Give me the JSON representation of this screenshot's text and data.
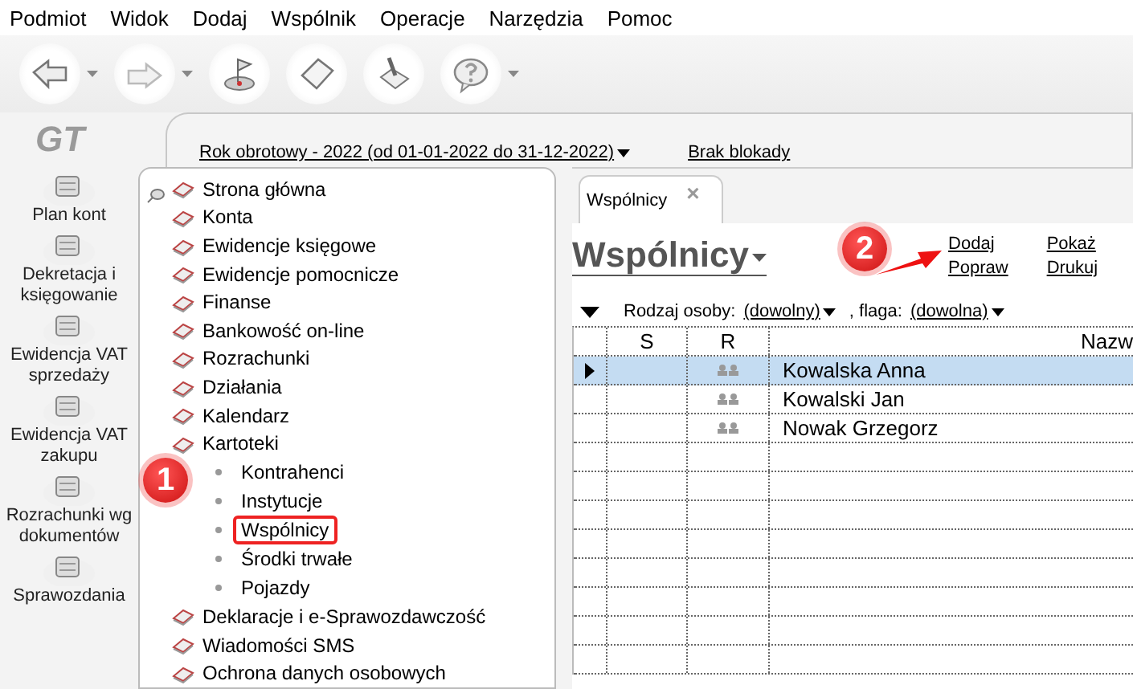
{
  "menu": [
    "Podmiot",
    "Widok",
    "Dodaj",
    "Wspólnik",
    "Operacje",
    "Narzędzia",
    "Pomoc"
  ],
  "toolbar": [
    {
      "kind": "back",
      "dropdown": true
    },
    {
      "kind": "forward",
      "dropdown": true
    },
    {
      "kind": "flag",
      "dropdown": false
    },
    {
      "kind": "page",
      "dropdown": false
    },
    {
      "kind": "brush",
      "dropdown": false
    },
    {
      "kind": "help",
      "dropdown": true
    }
  ],
  "logo": "GT",
  "sidebar": [
    {
      "label": "Plan kont"
    },
    {
      "label": "Dekretacja i księgowanie"
    },
    {
      "label": "Ewidencja VAT sprzedaży"
    },
    {
      "label": "Ewidencja VAT zakupu"
    },
    {
      "label": "Rozrachunki wg dokumentów"
    },
    {
      "label": "Sprawozdania"
    }
  ],
  "header": {
    "fiscal_year": "Rok obrotowy - 2022  (od 01-01-2022 do 31-12-2022)",
    "lock": "Brak blokady"
  },
  "tree": [
    {
      "label": "Strona główna"
    },
    {
      "label": "Konta"
    },
    {
      "label": "Ewidencje księgowe"
    },
    {
      "label": "Ewidencje pomocnicze"
    },
    {
      "label": "Finanse"
    },
    {
      "label": "Bankowość on-line"
    },
    {
      "label": "Rozrachunki"
    },
    {
      "label": "Działania"
    },
    {
      "label": "Kalendarz"
    },
    {
      "label": "Kartoteki",
      "children": [
        {
          "label": "Kontrahenci",
          "highlighted": false
        },
        {
          "label": "Instytucje",
          "highlighted": false
        },
        {
          "label": "Wspólnicy",
          "highlighted": true
        },
        {
          "label": "Środki trwałe",
          "highlighted": false
        },
        {
          "label": "Pojazdy",
          "highlighted": false
        }
      ]
    },
    {
      "label": "Deklaracje i e-Sprawozdawczość"
    },
    {
      "label": "Wiadomości SMS"
    },
    {
      "label": "Ochrona danych osobowych"
    }
  ],
  "callouts": [
    "1",
    "2"
  ],
  "tab": {
    "label": "Wspólnicy",
    "close": "×"
  },
  "title": "Wspólnicy",
  "actions": [
    [
      "Dodaj",
      "Popraw"
    ],
    [
      "Pokaż",
      "Drukuj"
    ]
  ],
  "filter": {
    "person_label": "Rodzaj osoby:",
    "person_value": "(dowolny)",
    "flag_label": ", flaga:",
    "flag_value": "(dowolna)"
  },
  "table": {
    "columns": [
      "",
      "S",
      "R",
      "Nazw"
    ],
    "rows": [
      {
        "name": "Kowalska Anna",
        "selected": true
      },
      {
        "name": "Kowalski Jan",
        "selected": false
      },
      {
        "name": "Nowak Grzegorz",
        "selected": false
      }
    ]
  }
}
